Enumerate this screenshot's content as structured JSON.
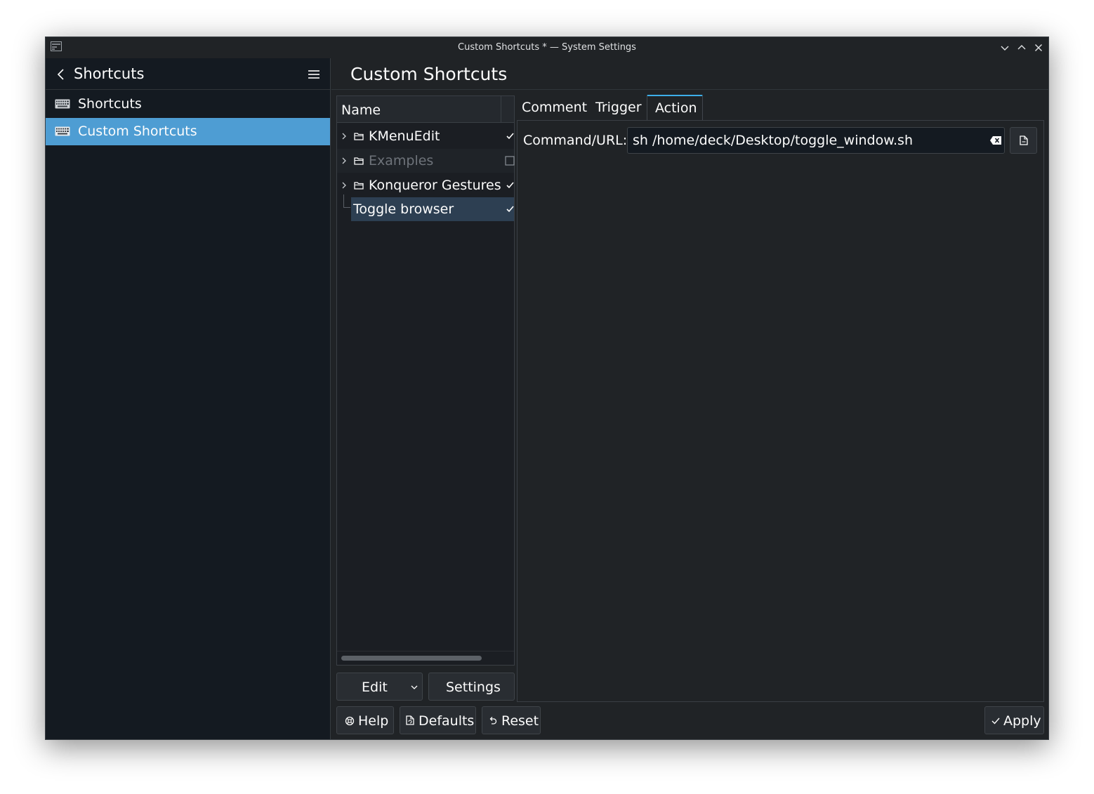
{
  "window": {
    "title": "Custom Shortcuts * — System Settings"
  },
  "sidebar": {
    "header_label": "Shortcuts",
    "items": [
      {
        "label": "Shortcuts",
        "icon": "keyboard-icon",
        "selected": false
      },
      {
        "label": "Custom Shortcuts",
        "icon": "keyboard-icon",
        "selected": true
      }
    ]
  },
  "main": {
    "page_title": "Custom Shortcuts",
    "tree": {
      "column_header": "Name",
      "rows": [
        {
          "label": "KMenuEdit",
          "type": "group",
          "enabled": true
        },
        {
          "label": "Examples",
          "type": "group",
          "enabled": false
        },
        {
          "label": "Konqueror Gestures",
          "type": "group",
          "enabled": true
        },
        {
          "label": "Toggle browser",
          "type": "action",
          "enabled": true,
          "selected": true
        }
      ]
    },
    "edit_button": "Edit",
    "settings_button": "Settings",
    "tabs": [
      {
        "label": "Comment",
        "active": false
      },
      {
        "label": "Trigger",
        "active": false
      },
      {
        "label": "Action",
        "active": true
      }
    ],
    "action": {
      "field_label": "Command/URL:",
      "command_value": "sh /home/deck/Desktop/toggle_window.sh"
    }
  },
  "footer": {
    "help": "Help",
    "defaults": "Defaults",
    "reset": "Reset",
    "apply": "Apply"
  },
  "colors": {
    "accent": "#3daee9",
    "selection": "#4e9dd3",
    "background": "#202326",
    "sidebar": "#141a21"
  }
}
